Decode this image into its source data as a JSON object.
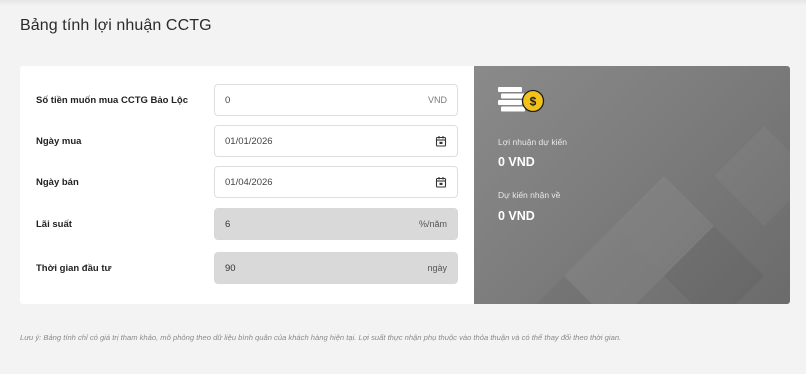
{
  "page": {
    "title": "Bảng tính lợi nhuận CCTG"
  },
  "form": {
    "amount": {
      "label": "Số tiền muốn mua CCTG Bảo Lộc",
      "value": "0",
      "unit": "VND"
    },
    "buy_date": {
      "label": "Ngày mua",
      "value": "01/01/2026",
      "icon": "calendar-icon"
    },
    "sell_date": {
      "label": "Ngày bán",
      "value": "01/04/2026",
      "icon": "calendar-icon"
    },
    "rate": {
      "label": "Lãi suất",
      "value": "6",
      "unit": "%/năm"
    },
    "term": {
      "label": "Thời gian đầu tư",
      "value": "90",
      "unit": "ngày"
    }
  },
  "result": {
    "icon": "coin-stack-icon",
    "expected_profit_label": "Lợi nhuận dự kiến",
    "expected_profit_value": "0 VND",
    "expected_receive_label": "Dự kiến nhận về",
    "expected_receive_value": "0 VND"
  },
  "note": "Lưu ý: Bảng tính chỉ có giá trị tham khảo, mô phỏng theo dữ liệu bình quân của khách hàng hiện tại. Lợi suất thực nhận phụ thuộc vào thỏa thuận và có thể thay đổi theo thời gian.",
  "colors": {
    "page_bg": "#f3f3f3",
    "result_bg": "#7d7d7d",
    "readonly_field": "#d9d9d9",
    "coin": "#f2c21b"
  }
}
